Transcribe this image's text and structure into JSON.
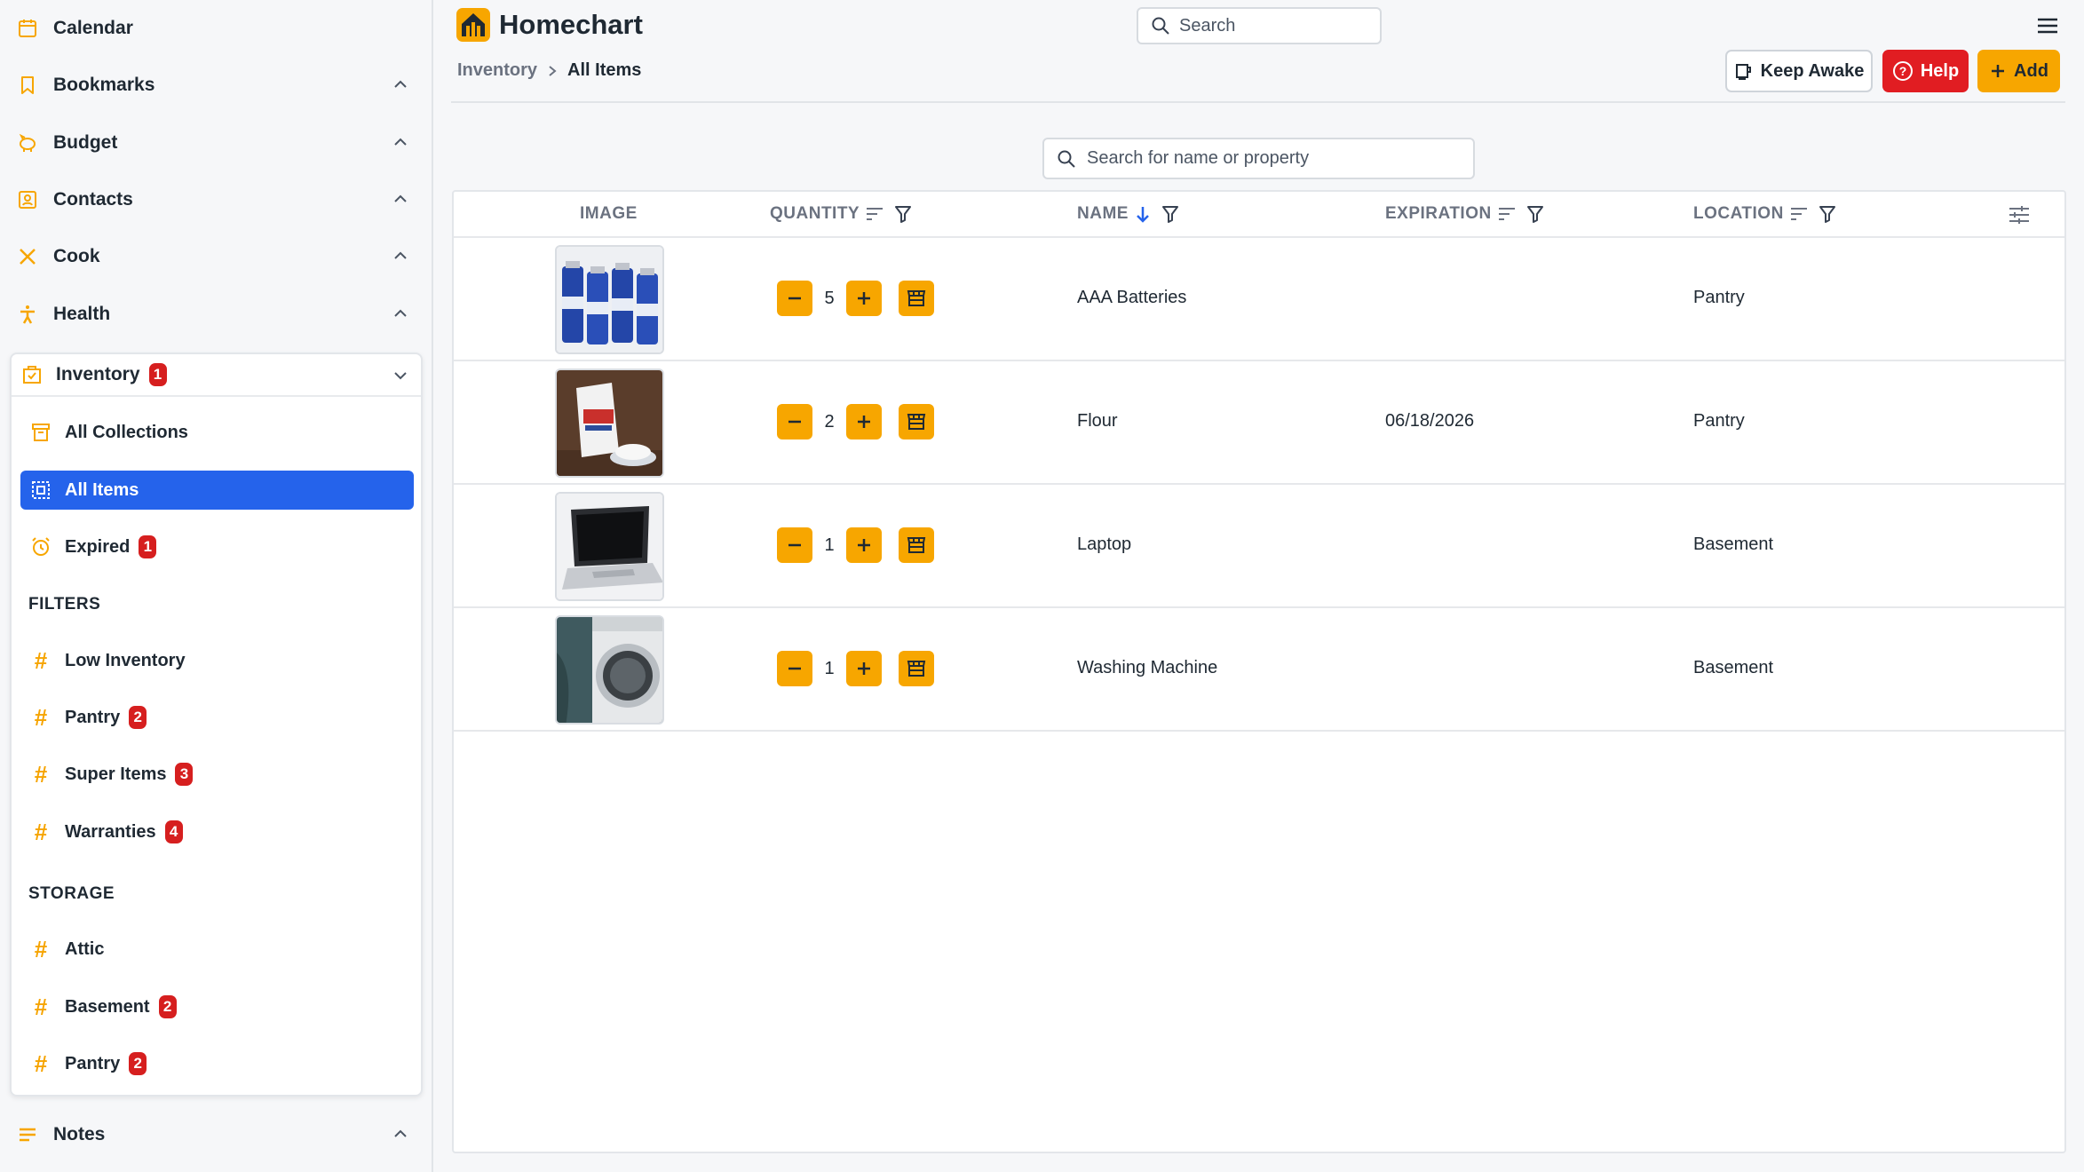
{
  "app": {
    "name": "Homechart"
  },
  "colors": {
    "accent": "#f7a600",
    "active": "#2563eb",
    "danger": "#e11d22",
    "badge": "#d61f1f"
  },
  "sidebar": {
    "items": [
      {
        "label": "Calendar",
        "icon": "calendar-icon"
      },
      {
        "label": "Bookmarks",
        "icon": "bookmark-icon"
      },
      {
        "label": "Budget",
        "icon": "piggy-bank-icon"
      },
      {
        "label": "Contacts",
        "icon": "contacts-icon"
      },
      {
        "label": "Cook",
        "icon": "utensils-icon"
      },
      {
        "label": "Health",
        "icon": "health-icon"
      }
    ],
    "inventory": {
      "label": "Inventory",
      "badge": "1",
      "items": [
        {
          "label": "All Collections",
          "icon": "archive-icon"
        },
        {
          "label": "All Items",
          "icon": "grid-icon"
        },
        {
          "label": "Expired",
          "icon": "alarm-icon",
          "badge": "1"
        }
      ],
      "filters_label": "FILTERS",
      "filters": [
        {
          "label": "Low Inventory",
          "badge": ""
        },
        {
          "label": "Pantry",
          "badge": "2"
        },
        {
          "label": "Super Items",
          "badge": "3"
        },
        {
          "label": "Warranties",
          "badge": "4"
        }
      ],
      "storage_label": "STORAGE",
      "storage": [
        {
          "label": "Attic",
          "badge": ""
        },
        {
          "label": "Basement",
          "badge": "2"
        },
        {
          "label": "Pantry",
          "badge": "2"
        }
      ]
    },
    "notes": {
      "label": "Notes",
      "icon": "notes-icon"
    }
  },
  "header": {
    "search_placeholder": "Search",
    "breadcrumb": [
      "Inventory",
      "All Items"
    ],
    "buttons": {
      "keep_awake": "Keep Awake",
      "help": "Help",
      "add": "Add"
    }
  },
  "table": {
    "search_placeholder": "Search for name or property",
    "columns": [
      "IMAGE",
      "QUANTITY",
      "NAME",
      "EXPIRATION",
      "LOCATION"
    ],
    "rows": [
      {
        "quantity": "5",
        "name": "AAA Batteries",
        "expiration": "",
        "location": "Pantry",
        "image": "batteries"
      },
      {
        "quantity": "2",
        "name": "Flour",
        "expiration": "06/18/2026",
        "location": "Pantry",
        "image": "flour"
      },
      {
        "quantity": "1",
        "name": "Laptop",
        "expiration": "",
        "location": "Basement",
        "image": "laptop"
      },
      {
        "quantity": "1",
        "name": "Washing Machine",
        "expiration": "",
        "location": "Basement",
        "image": "washer"
      }
    ]
  }
}
